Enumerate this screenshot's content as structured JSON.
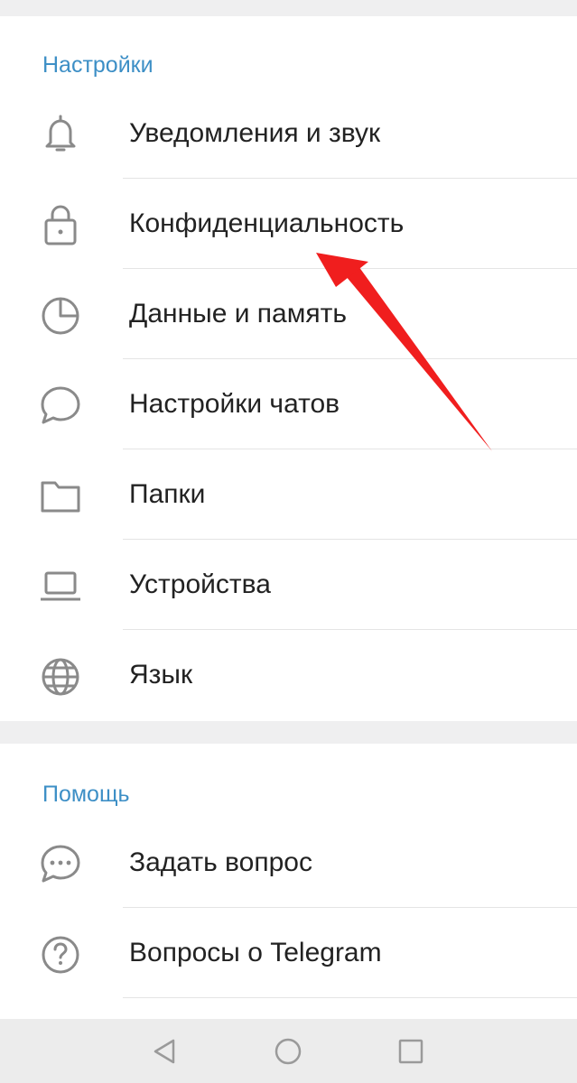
{
  "settings_section": {
    "header": "Настройки",
    "items": [
      {
        "label": "Уведомления и звук",
        "icon": "bell-icon"
      },
      {
        "label": "Конфиденциальность",
        "icon": "lock-icon"
      },
      {
        "label": "Данные и память",
        "icon": "pie-chart-icon"
      },
      {
        "label": "Настройки чатов",
        "icon": "chat-bubble-icon"
      },
      {
        "label": "Папки",
        "icon": "folder-icon"
      },
      {
        "label": "Устройства",
        "icon": "laptop-icon"
      },
      {
        "label": "Язык",
        "icon": "globe-icon"
      }
    ]
  },
  "help_section": {
    "header": "Помощь",
    "items": [
      {
        "label": "Задать вопрос",
        "icon": "chat-dots-icon"
      },
      {
        "label": "Вопросы о Telegram",
        "icon": "question-circle-icon"
      }
    ]
  },
  "navbar": {
    "buttons": [
      "back-icon",
      "home-icon",
      "recents-icon"
    ]
  },
  "colors": {
    "accent": "#3d8fc6",
    "annotation_arrow": "#f01e1e",
    "icon_gray": "#8a8a8a"
  }
}
